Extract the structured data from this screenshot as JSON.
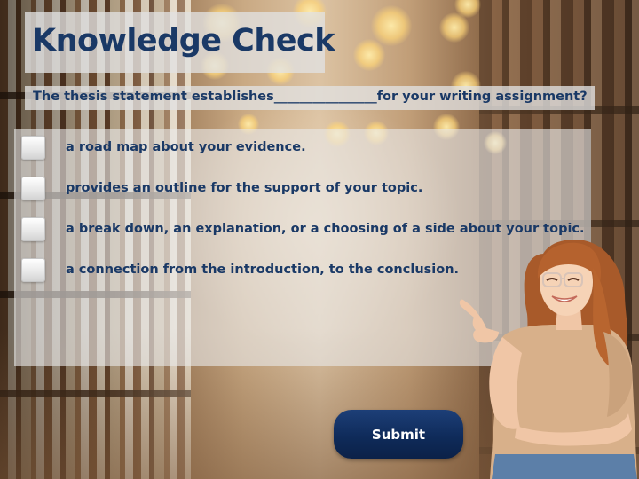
{
  "title": "Knowledge Check",
  "question": "The thesis statement establishes________________for your writing assignment?",
  "options": [
    {
      "label": " a road map about your evidence.",
      "checked": false
    },
    {
      "label": "provides an outline for the support of your topic.",
      "checked": false
    },
    {
      "label": "a break down, an explanation, or a choosing of a side about your topic.",
      "checked": false
    },
    {
      "label": "a connection from the introduction, to the conclusion.",
      "checked": false
    }
  ],
  "submit_label": "Submit",
  "colors": {
    "text_navy": "#1a3966",
    "submit_bg": "#0f2b5a",
    "panel_gray": "#e1e1e1"
  },
  "images": {
    "background": "blurred library bookshelves with warm bokeh lights",
    "presenter": "smiling young woman with glasses pointing up"
  }
}
